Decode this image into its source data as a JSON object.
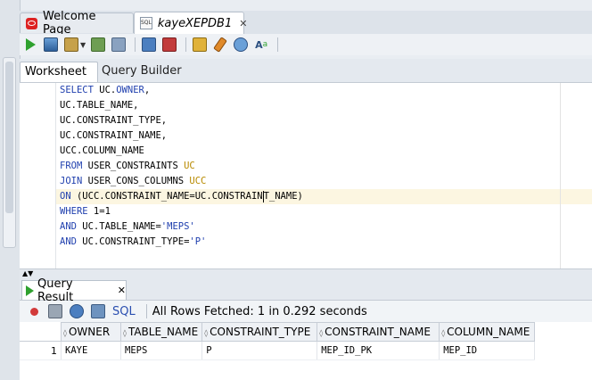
{
  "tabs": [
    {
      "label": "Welcome Page",
      "icon": "oracle-icon"
    },
    {
      "label": "kayeXEPDB1",
      "icon": "sql-file-icon",
      "close": "✕"
    }
  ],
  "toolbar": {
    "icons": [
      "run-statement-icon",
      "run-script-icon",
      "autotrace-icon",
      "explain-plan-icon",
      "sql-tuning-icon",
      "commit-icon",
      "rollback-icon",
      "unshared-sql-icon",
      "clear-icon",
      "history-icon",
      "format-icon"
    ]
  },
  "subtabs": {
    "worksheet": "Worksheet",
    "query_builder": "Query Builder"
  },
  "code": {
    "l1": {
      "kw": "SELECT",
      "rest": " UC.",
      "tail": "OWNER",
      "end": ","
    },
    "l2": "UC.TABLE_NAME,",
    "l3": "UC.CONSTRAINT_TYPE,",
    "l4": "UC.CONSTRAINT_NAME,",
    "l5": "UCC.COLUMN_NAME",
    "l6": {
      "kw": "FROM",
      "rest": " USER_CONSTRAINTS ",
      "alias": "UC"
    },
    "l7": {
      "kw": "JOIN",
      "rest": " USER_CONS_COLUMNS ",
      "alias": "UCC"
    },
    "l8": {
      "kw": "ON",
      "rest_a": " (UCC.CONSTRAINT_NAME=UC.CONSTRAIN",
      "rest_b": "T_NAME)"
    },
    "l9": {
      "kw": "WHERE",
      "rest": " 1=1"
    },
    "l10": {
      "kw": "AND",
      "rest": " UC.TABLE_NAME=",
      "str": "'MEPS'"
    },
    "l11": {
      "kw": "AND",
      "rest": " UC.CONSTRAINT_TYPE=",
      "str": "'P'"
    }
  },
  "result": {
    "tab_label": "Query Result",
    "close": "✕",
    "sql_link": "SQL",
    "status": "All Rows Fetched: 1 in 0.292 seconds",
    "columns": [
      "OWNER",
      "TABLE_NAME",
      "CONSTRAINT_TYPE",
      "CONSTRAINT_NAME",
      "COLUMN_NAME"
    ],
    "rows": [
      {
        "num": "1",
        "cells": [
          "KAYE",
          "MEPS",
          "P",
          "MEP_ID_PK",
          "MEP_ID"
        ]
      }
    ]
  }
}
